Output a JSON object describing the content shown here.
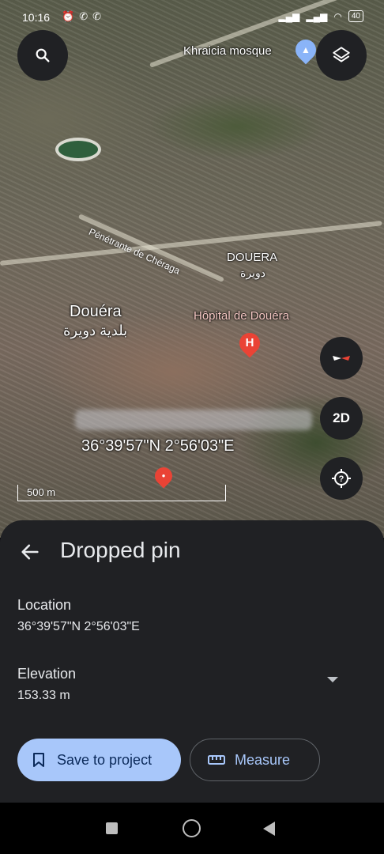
{
  "status_bar": {
    "time": "10:16",
    "notification_icons": [
      "alarm-icon",
      "phone-icon",
      "phone-icon"
    ],
    "battery": "40"
  },
  "map": {
    "labels": {
      "mosque": "Khraicia mosque",
      "road": "Pénétrante de Chéraga",
      "douera_upper_latin": "DOUERA",
      "douera_upper_arabic": "دويرة",
      "douera_latin": "Douéra",
      "douera_arabic": "بلدية دويرة",
      "hospital": "Hôpital de Douéra",
      "coordinates": "36°39'57\"N 2°56'03\"E",
      "scale": "500 m"
    },
    "buttons": {
      "view_mode": "2D"
    },
    "hospital_pin_letter": "H",
    "pin_color": "#ea4335"
  },
  "sheet": {
    "title": "Dropped pin",
    "location_label": "Location",
    "location_value": "36°39'57\"N 2°56'03\"E",
    "elevation_label": "Elevation",
    "elevation_value": "153.33 m",
    "save_button": "Save to project",
    "measure_button": "Measure"
  },
  "colors": {
    "sheet_bg": "#202124",
    "primary_button": "#a8c7fa",
    "accent_text": "#a8c7fa"
  }
}
